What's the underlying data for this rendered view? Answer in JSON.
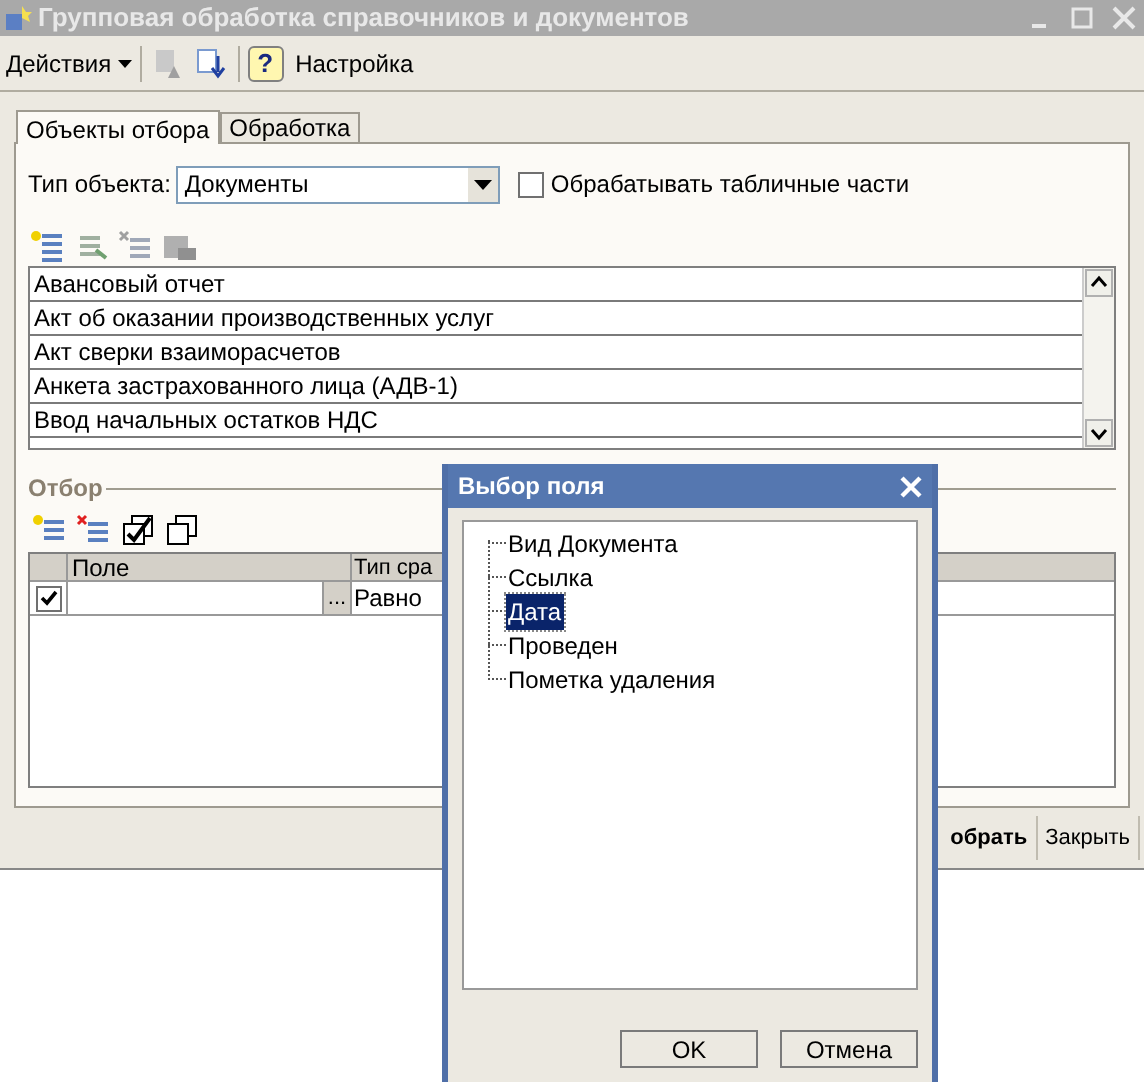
{
  "window": {
    "title": "Групповая обработка справочников и документов"
  },
  "toolbar": {
    "actions_menu": "Действия",
    "help": "?",
    "settings": "Настройка"
  },
  "tabs": [
    {
      "label": "Объекты отбора",
      "selected": true
    },
    {
      "label": "Обработка",
      "selected": false
    }
  ],
  "object_type": {
    "label": "Тип объекта:",
    "value": "Документы"
  },
  "process_tabular_parts": {
    "label": "Обрабатывать табличные части",
    "checked": false
  },
  "object_list": {
    "rows": [
      "Авансовый отчет",
      "Акт об оказании производственных услуг",
      "Акт сверки взаиморасчетов",
      "Анкета застрахованного лица (АДВ-1)",
      "Ввод начальных остатков НДС"
    ]
  },
  "filter": {
    "title": "Отбор",
    "columns": [
      "Поле",
      "Тип сра"
    ],
    "rows": [
      {
        "checked": true,
        "select_button": "...",
        "comparison": "Равно"
      }
    ]
  },
  "bottom_buttons": [
    {
      "label": "обрать",
      "default": true
    },
    {
      "label": "Закрыть",
      "default": false
    }
  ],
  "dialog": {
    "title": "Выбор поля",
    "tree": [
      {
        "label": "Вид Документа",
        "selected": false
      },
      {
        "label": "Ссылка",
        "selected": false
      },
      {
        "label": "Дата",
        "selected": true
      },
      {
        "label": "Проведен",
        "selected": false
      },
      {
        "label": "Пометка удаления",
        "selected": false
      }
    ],
    "buttons": [
      "OK",
      "Отмена"
    ]
  }
}
